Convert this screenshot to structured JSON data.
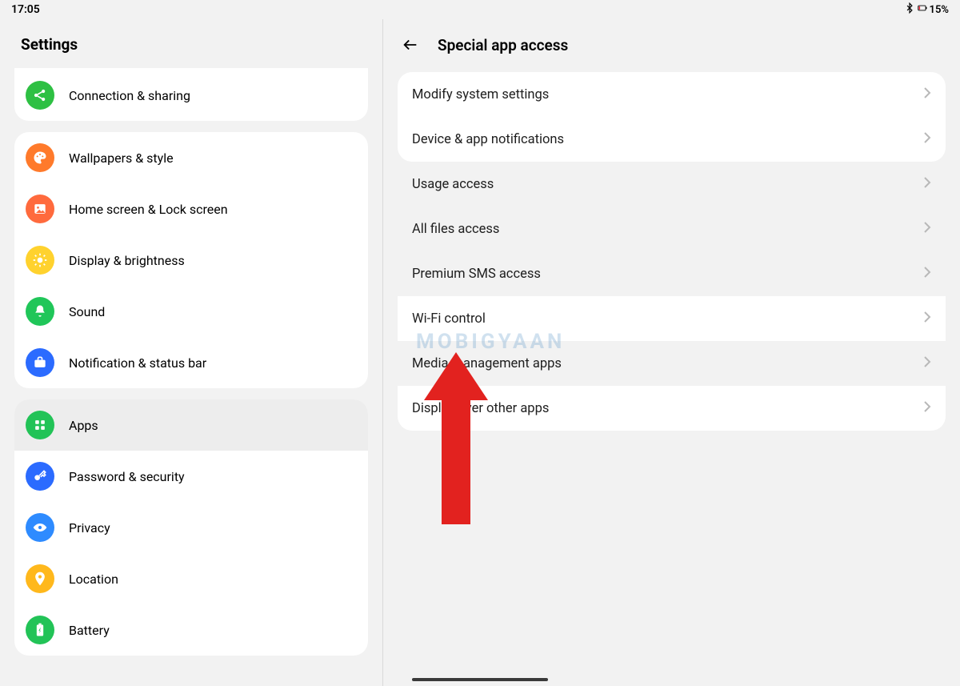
{
  "status": {
    "time": "17:05",
    "battery_pct": "15%"
  },
  "left": {
    "title": "Settings",
    "groups": [
      {
        "cardClass": "card-partial",
        "items": [
          {
            "id": "connection-sharing",
            "label": "Connection & sharing",
            "color": "#2ec043",
            "icon": "share"
          }
        ]
      },
      {
        "items": [
          {
            "id": "wallpapers-style",
            "label": "Wallpapers & style",
            "color": "#ff7a2b",
            "icon": "palette"
          },
          {
            "id": "home-lock-screen",
            "label": "Home screen & Lock screen",
            "color": "#ff6a3d",
            "icon": "image"
          },
          {
            "id": "display-brightness",
            "label": "Display & brightness",
            "color": "#ffd22e",
            "icon": "sun"
          },
          {
            "id": "sound",
            "label": "Sound",
            "color": "#20c659",
            "icon": "bell"
          },
          {
            "id": "notification-status",
            "label": "Notification & status bar",
            "color": "#2b6bff",
            "icon": "briefcase"
          }
        ]
      },
      {
        "items": [
          {
            "id": "apps",
            "label": "Apps",
            "color": "#22c357",
            "icon": "grid",
            "selected": true
          },
          {
            "id": "password-security",
            "label": "Password & security",
            "color": "#2b6bff",
            "icon": "key"
          },
          {
            "id": "privacy",
            "label": "Privacy",
            "color": "#2e8bff",
            "icon": "eye"
          },
          {
            "id": "location",
            "label": "Location",
            "color": "#ffb81c",
            "icon": "pin"
          },
          {
            "id": "battery",
            "label": "Battery",
            "color": "#22c357",
            "icon": "battery"
          }
        ]
      }
    ]
  },
  "right": {
    "title": "Special app access",
    "options": [
      {
        "id": "modify-system-settings",
        "label": "Modify system settings",
        "highlighted": true,
        "posClass": "first-group"
      },
      {
        "id": "device-app-notifications",
        "label": "Device & app notifications",
        "highlighted": true,
        "posClass": "last-group"
      },
      {
        "id": "usage-access",
        "label": "Usage access"
      },
      {
        "id": "all-files-access",
        "label": "All files access"
      },
      {
        "id": "premium-sms-access",
        "label": "Premium SMS access"
      },
      {
        "id": "wifi-control",
        "label": "Wi-Fi control",
        "highlighted": true
      },
      {
        "id": "media-management-apps",
        "label": "Media management apps"
      },
      {
        "id": "display-over-other-apps",
        "label": "Display over other apps",
        "highlighted": true,
        "posClass": "last-group"
      }
    ]
  },
  "watermark": "MOBIGYAAN"
}
